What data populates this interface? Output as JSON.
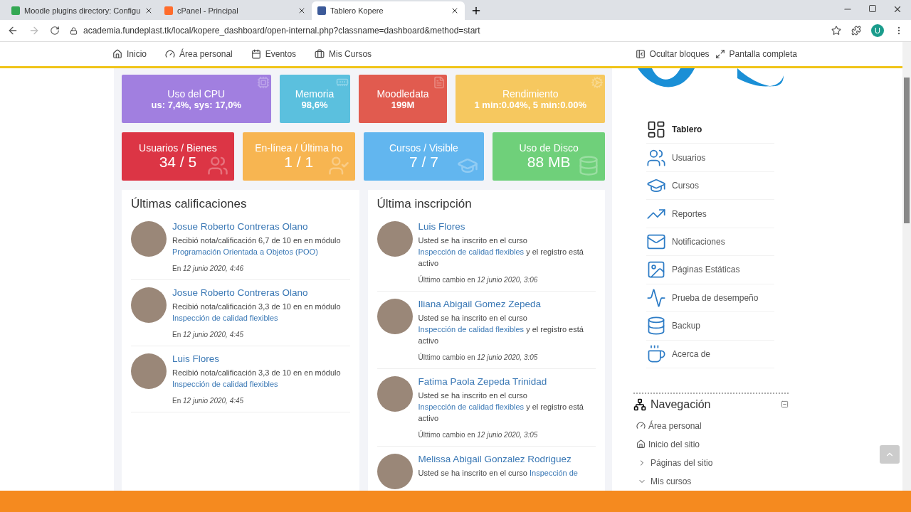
{
  "browser": {
    "tabs": [
      {
        "title": "Moodle plugins directory: Configu",
        "selected": false
      },
      {
        "title": "cPanel - Principal",
        "selected": false
      },
      {
        "title": "Tablero Kopere",
        "selected": true
      }
    ],
    "address": "academia.fundeplast.tk/local/kopere_dashboard/open-internal.php?classname=dashboard&method=start",
    "profile": "U"
  },
  "topnav": {
    "left": [
      "Inicio",
      "Área personal",
      "Eventos",
      "Mis Cursos"
    ],
    "right": [
      "Ocultar bloques",
      "Pantalla completa"
    ]
  },
  "tiles": [
    [
      {
        "title": "Uso del CPU",
        "value": "us: 7,4%, sys: 17,0%",
        "color": "#a17fe0"
      },
      {
        "title": "Memoria",
        "value": "98,6%",
        "color": "#5bc0de"
      },
      {
        "title": "Moodledata",
        "value": "199M",
        "color": "#e15b4f"
      },
      {
        "title": "Rendimiento",
        "value": "1 min:0.04%, 5 min:0.00%",
        "color": "#f6c85f"
      }
    ],
    [
      {
        "title": "Usuarios / Bienes",
        "value": "34 / 5",
        "color": "#dc3545"
      },
      {
        "title": "En-línea / Última ho",
        "value": "1 / 1",
        "color": "#f7b551"
      },
      {
        "title": "Cursos / Visible",
        "value": "7 / 7",
        "color": "#62b6ef"
      },
      {
        "title": "Uso de Disco",
        "value": "88 MB",
        "color": "#6fd07a"
      }
    ]
  ],
  "grades": {
    "title": "Últimas calificaciones",
    "items": [
      {
        "name": "Josue Roberto Contreras Olano",
        "text": "Recibió nota/calificación 6,7 de 10 en en módulo",
        "link": "Programación Orientada a Objetos (POO)",
        "date": "En *12 junio 2020, 4:46*"
      },
      {
        "name": "Josue Roberto Contreras Olano",
        "text": "Recibió nota/calificación 3,3 de 10 en en módulo",
        "link": "Inspección de calidad flexibles",
        "date": "En *12 junio 2020, 4:45*"
      },
      {
        "name": "Luis Flores",
        "text": "Recibió nota/calificación 3,3 de 10 en en módulo",
        "link": "Inspección de calidad flexibles",
        "date": "En *12 junio 2020, 4:45*"
      }
    ]
  },
  "enrollments": {
    "title": "Última inscripción",
    "items": [
      {
        "name": "Luis Flores",
        "text": "Usted se ha inscrito en el curso",
        "link": "Inspección de calidad flexibles",
        "after": "y el registro está activo",
        "changed": "Últtimo cambio en *12 junio 2020, 3:06*"
      },
      {
        "name": "Iliana Abigail Gomez Zepeda",
        "text": "Usted se ha inscrito en el curso",
        "link": "Inspección de calidad flexibles",
        "after": "y el registro está activo",
        "changed": "Últtimo cambio en *12 junio 2020, 3:05*"
      },
      {
        "name": "Fatima Paola Zepeda Trinidad",
        "text": "Usted se ha inscrito en el curso",
        "link": "Inspección de calidad flexibles",
        "after": "y el registro está activo",
        "changed": "Últtimo cambio en *12 junio 2020, 3:05*"
      },
      {
        "name": "Melissa Abigail Gonzalez Rodriguez",
        "text": "Usted se ha inscrito en el curso",
        "link": "Inspección de"
      }
    ]
  },
  "menu": [
    {
      "label": "Tablero",
      "selected": true
    },
    {
      "label": "Usuarios",
      "selected": false
    },
    {
      "label": "Cursos",
      "selected": false
    },
    {
      "label": "Reportes",
      "selected": false
    },
    {
      "label": "Notificaciones",
      "selected": false
    },
    {
      "label": "Páginas Estáticas",
      "selected": false
    },
    {
      "label": "Prueba de desempeño",
      "selected": false
    },
    {
      "label": "Backup",
      "selected": false
    },
    {
      "label": "Acerca de",
      "selected": false
    }
  ],
  "navigation": {
    "title": "Navegación",
    "items": [
      {
        "kind": "dashboard",
        "label": "Área personal"
      },
      {
        "kind": "home",
        "label": "Inicio del sitio"
      },
      {
        "kind": "branch",
        "label": "Páginas del sitio",
        "expanded": false
      },
      {
        "kind": "branch",
        "label": "Mis cursos",
        "expanded": true
      }
    ]
  }
}
